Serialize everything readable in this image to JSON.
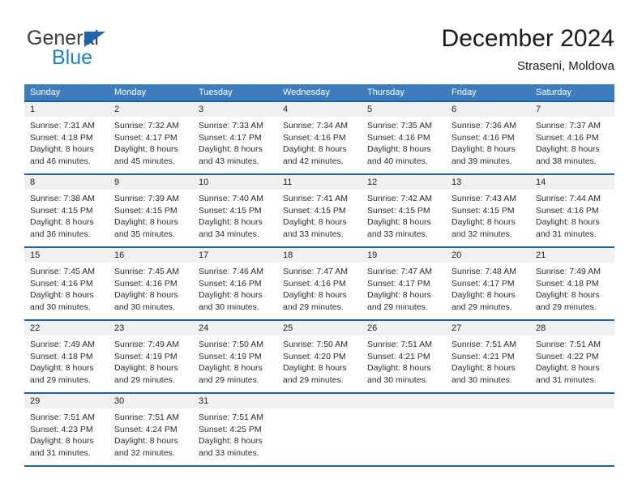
{
  "brand": {
    "line1": "General",
    "line2": "Blue",
    "icon": "triangle-logo-icon"
  },
  "header": {
    "title": "December 2024",
    "subtitle": "Straseni, Moldova"
  },
  "calendar": {
    "weekdays": [
      "Sunday",
      "Monday",
      "Tuesday",
      "Wednesday",
      "Thursday",
      "Friday",
      "Saturday"
    ],
    "colors": {
      "header_bg": "#3d7cbd",
      "row_divider": "#1b64a8",
      "day_band_bg": "#f0f0f0",
      "brand_blue": "#1b7fd4",
      "brand_dark": "#3c3c3c"
    },
    "weeks": [
      [
        {
          "day": "1",
          "sunrise": "Sunrise: 7:31 AM",
          "sunset": "Sunset: 4:18 PM",
          "daylight1": "Daylight: 8 hours",
          "daylight2": "and 46 minutes."
        },
        {
          "day": "2",
          "sunrise": "Sunrise: 7:32 AM",
          "sunset": "Sunset: 4:17 PM",
          "daylight1": "Daylight: 8 hours",
          "daylight2": "and 45 minutes."
        },
        {
          "day": "3",
          "sunrise": "Sunrise: 7:33 AM",
          "sunset": "Sunset: 4:17 PM",
          "daylight1": "Daylight: 8 hours",
          "daylight2": "and 43 minutes."
        },
        {
          "day": "4",
          "sunrise": "Sunrise: 7:34 AM",
          "sunset": "Sunset: 4:16 PM",
          "daylight1": "Daylight: 8 hours",
          "daylight2": "and 42 minutes."
        },
        {
          "day": "5",
          "sunrise": "Sunrise: 7:35 AM",
          "sunset": "Sunset: 4:16 PM",
          "daylight1": "Daylight: 8 hours",
          "daylight2": "and 40 minutes."
        },
        {
          "day": "6",
          "sunrise": "Sunrise: 7:36 AM",
          "sunset": "Sunset: 4:16 PM",
          "daylight1": "Daylight: 8 hours",
          "daylight2": "and 39 minutes."
        },
        {
          "day": "7",
          "sunrise": "Sunrise: 7:37 AM",
          "sunset": "Sunset: 4:16 PM",
          "daylight1": "Daylight: 8 hours",
          "daylight2": "and 38 minutes."
        }
      ],
      [
        {
          "day": "8",
          "sunrise": "Sunrise: 7:38 AM",
          "sunset": "Sunset: 4:15 PM",
          "daylight1": "Daylight: 8 hours",
          "daylight2": "and 36 minutes."
        },
        {
          "day": "9",
          "sunrise": "Sunrise: 7:39 AM",
          "sunset": "Sunset: 4:15 PM",
          "daylight1": "Daylight: 8 hours",
          "daylight2": "and 35 minutes."
        },
        {
          "day": "10",
          "sunrise": "Sunrise: 7:40 AM",
          "sunset": "Sunset: 4:15 PM",
          "daylight1": "Daylight: 8 hours",
          "daylight2": "and 34 minutes."
        },
        {
          "day": "11",
          "sunrise": "Sunrise: 7:41 AM",
          "sunset": "Sunset: 4:15 PM",
          "daylight1": "Daylight: 8 hours",
          "daylight2": "and 33 minutes."
        },
        {
          "day": "12",
          "sunrise": "Sunrise: 7:42 AM",
          "sunset": "Sunset: 4:15 PM",
          "daylight1": "Daylight: 8 hours",
          "daylight2": "and 33 minutes."
        },
        {
          "day": "13",
          "sunrise": "Sunrise: 7:43 AM",
          "sunset": "Sunset: 4:15 PM",
          "daylight1": "Daylight: 8 hours",
          "daylight2": "and 32 minutes."
        },
        {
          "day": "14",
          "sunrise": "Sunrise: 7:44 AM",
          "sunset": "Sunset: 4:16 PM",
          "daylight1": "Daylight: 8 hours",
          "daylight2": "and 31 minutes."
        }
      ],
      [
        {
          "day": "15",
          "sunrise": "Sunrise: 7:45 AM",
          "sunset": "Sunset: 4:16 PM",
          "daylight1": "Daylight: 8 hours",
          "daylight2": "and 30 minutes."
        },
        {
          "day": "16",
          "sunrise": "Sunrise: 7:45 AM",
          "sunset": "Sunset: 4:16 PM",
          "daylight1": "Daylight: 8 hours",
          "daylight2": "and 30 minutes."
        },
        {
          "day": "17",
          "sunrise": "Sunrise: 7:46 AM",
          "sunset": "Sunset: 4:16 PM",
          "daylight1": "Daylight: 8 hours",
          "daylight2": "and 30 minutes."
        },
        {
          "day": "18",
          "sunrise": "Sunrise: 7:47 AM",
          "sunset": "Sunset: 4:16 PM",
          "daylight1": "Daylight: 8 hours",
          "daylight2": "and 29 minutes."
        },
        {
          "day": "19",
          "sunrise": "Sunrise: 7:47 AM",
          "sunset": "Sunset: 4:17 PM",
          "daylight1": "Daylight: 8 hours",
          "daylight2": "and 29 minutes."
        },
        {
          "day": "20",
          "sunrise": "Sunrise: 7:48 AM",
          "sunset": "Sunset: 4:17 PM",
          "daylight1": "Daylight: 8 hours",
          "daylight2": "and 29 minutes."
        },
        {
          "day": "21",
          "sunrise": "Sunrise: 7:49 AM",
          "sunset": "Sunset: 4:18 PM",
          "daylight1": "Daylight: 8 hours",
          "daylight2": "and 29 minutes."
        }
      ],
      [
        {
          "day": "22",
          "sunrise": "Sunrise: 7:49 AM",
          "sunset": "Sunset: 4:18 PM",
          "daylight1": "Daylight: 8 hours",
          "daylight2": "and 29 minutes."
        },
        {
          "day": "23",
          "sunrise": "Sunrise: 7:49 AM",
          "sunset": "Sunset: 4:19 PM",
          "daylight1": "Daylight: 8 hours",
          "daylight2": "and 29 minutes."
        },
        {
          "day": "24",
          "sunrise": "Sunrise: 7:50 AM",
          "sunset": "Sunset: 4:19 PM",
          "daylight1": "Daylight: 8 hours",
          "daylight2": "and 29 minutes."
        },
        {
          "day": "25",
          "sunrise": "Sunrise: 7:50 AM",
          "sunset": "Sunset: 4:20 PM",
          "daylight1": "Daylight: 8 hours",
          "daylight2": "and 29 minutes."
        },
        {
          "day": "26",
          "sunrise": "Sunrise: 7:51 AM",
          "sunset": "Sunset: 4:21 PM",
          "daylight1": "Daylight: 8 hours",
          "daylight2": "and 30 minutes."
        },
        {
          "day": "27",
          "sunrise": "Sunrise: 7:51 AM",
          "sunset": "Sunset: 4:21 PM",
          "daylight1": "Daylight: 8 hours",
          "daylight2": "and 30 minutes."
        },
        {
          "day": "28",
          "sunrise": "Sunrise: 7:51 AM",
          "sunset": "Sunset: 4:22 PM",
          "daylight1": "Daylight: 8 hours",
          "daylight2": "and 31 minutes."
        }
      ],
      [
        {
          "day": "29",
          "sunrise": "Sunrise: 7:51 AM",
          "sunset": "Sunset: 4:23 PM",
          "daylight1": "Daylight: 8 hours",
          "daylight2": "and 31 minutes."
        },
        {
          "day": "30",
          "sunrise": "Sunrise: 7:51 AM",
          "sunset": "Sunset: 4:24 PM",
          "daylight1": "Daylight: 8 hours",
          "daylight2": "and 32 minutes."
        },
        {
          "day": "31",
          "sunrise": "Sunrise: 7:51 AM",
          "sunset": "Sunset: 4:25 PM",
          "daylight1": "Daylight: 8 hours",
          "daylight2": "and 33 minutes."
        },
        {
          "day": "",
          "sunrise": "",
          "sunset": "",
          "daylight1": "",
          "daylight2": ""
        },
        {
          "day": "",
          "sunrise": "",
          "sunset": "",
          "daylight1": "",
          "daylight2": ""
        },
        {
          "day": "",
          "sunrise": "",
          "sunset": "",
          "daylight1": "",
          "daylight2": ""
        },
        {
          "day": "",
          "sunrise": "",
          "sunset": "",
          "daylight1": "",
          "daylight2": ""
        }
      ]
    ]
  }
}
